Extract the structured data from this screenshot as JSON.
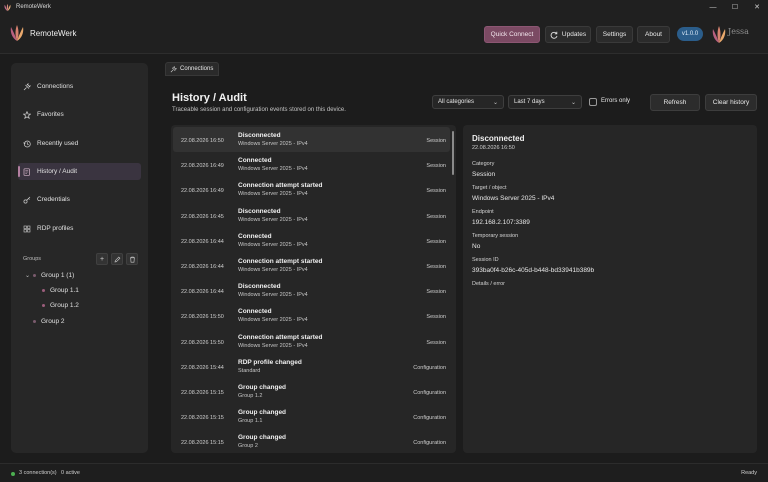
{
  "window": {
    "title": "RemoteWerk",
    "controls": [
      "—",
      "☐",
      "✕"
    ]
  },
  "header": {
    "brand": "RemoteWerk",
    "quick_connect": "Quick Connect",
    "updates": "Updates",
    "settings": "Settings",
    "about": "About",
    "version": "v1.0.0",
    "partner": "Jessa",
    "accent_color": "#7b4a63"
  },
  "sidebar": {
    "items": [
      {
        "label": "Connections",
        "icon": "plug-icon"
      },
      {
        "label": "Favorites",
        "icon": "star-icon"
      },
      {
        "label": "Recently used",
        "icon": "history-icon"
      },
      {
        "label": "History / Audit",
        "icon": "audit-icon",
        "active": true
      },
      {
        "label": "Credentials",
        "icon": "key-icon"
      },
      {
        "label": "RDP profiles",
        "icon": "grid-icon"
      }
    ],
    "groups_label": "Groups",
    "group_buttons": [
      "+",
      "✎",
      "🗑"
    ],
    "tree": [
      {
        "label": "Group 1 (1)",
        "level": 0,
        "expanded": true
      },
      {
        "label": "Group 1.1",
        "level": 1
      },
      {
        "label": "Group 1.2",
        "level": 1
      },
      {
        "label": "Group 2",
        "level": 0
      }
    ]
  },
  "tab": {
    "label": "Connections"
  },
  "page": {
    "title": "History / Audit",
    "subtitle": "Traceable session and configuration events stored on this device.",
    "category_filter": "All categories",
    "range_filter": "Last 7 days",
    "errors_only": "Errors only",
    "refresh": "Refresh",
    "clear": "Clear history"
  },
  "events": [
    {
      "time": "22.08.2026 16:50",
      "event": "Disconnected",
      "target": "Windows Server 2025 - IPv4",
      "category": "Session"
    },
    {
      "time": "22.08.2026 16:49",
      "event": "Connected",
      "target": "Windows Server 2025 - IPv4",
      "category": "Session"
    },
    {
      "time": "22.08.2026 16:49",
      "event": "Connection attempt started",
      "target": "Windows Server 2025 - IPv4",
      "category": "Session"
    },
    {
      "time": "22.08.2026 16:45",
      "event": "Disconnected",
      "target": "Windows Server 2025 - IPv4",
      "category": "Session"
    },
    {
      "time": "22.08.2026 16:44",
      "event": "Connected",
      "target": "Windows Server 2025 - IPv4",
      "category": "Session"
    },
    {
      "time": "22.08.2026 16:44",
      "event": "Connection attempt started",
      "target": "Windows Server 2025 - IPv4",
      "category": "Session"
    },
    {
      "time": "22.08.2026 16:44",
      "event": "Disconnected",
      "target": "Windows Server 2025 - IPv4",
      "category": "Session"
    },
    {
      "time": "22.08.2026 15:50",
      "event": "Connected",
      "target": "Windows Server 2025 - IPv4",
      "category": "Session"
    },
    {
      "time": "22.08.2026 15:50",
      "event": "Connection attempt started",
      "target": "Windows Server 2025 - IPv4",
      "category": "Session"
    },
    {
      "time": "22.08.2026 15:44",
      "event": "RDP profile changed",
      "target": "Standard",
      "category": "Configuration"
    },
    {
      "time": "22.08.2026 15:15",
      "event": "Group changed",
      "target": "Group 1.2",
      "category": "Configuration"
    },
    {
      "time": "22.08.2026 15:15",
      "event": "Group changed",
      "target": "Group 1.1",
      "category": "Configuration"
    },
    {
      "time": "22.08.2026 15:15",
      "event": "Group changed",
      "target": "Group 2",
      "category": "Configuration"
    }
  ],
  "detail": {
    "title": "Disconnected",
    "time": "22.08.2026 16:50",
    "fields": [
      {
        "label": "Category",
        "value": "Session"
      },
      {
        "label": "Target / object",
        "value": "Windows Server 2025 - IPv4"
      },
      {
        "label": "Endpoint",
        "value": "192.168.2.107:3389"
      },
      {
        "label": "Temporary session",
        "value": "No"
      },
      {
        "label": "Session ID",
        "value": "393ba0f4-b26c-405d-b448-bd33941b389b"
      },
      {
        "label": "Details / error",
        "value": ""
      }
    ]
  },
  "status": {
    "connections": "3 connection(s)",
    "active": "0 active",
    "ready": "Ready"
  }
}
